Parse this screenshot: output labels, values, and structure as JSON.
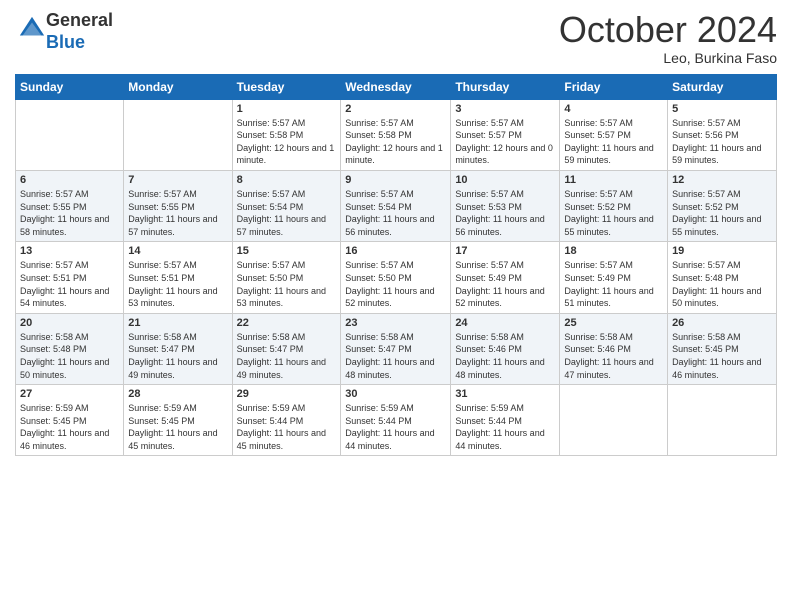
{
  "header": {
    "logo_general": "General",
    "logo_blue": "Blue",
    "month_title": "October 2024",
    "subtitle": "Leo, Burkina Faso"
  },
  "days_of_week": [
    "Sunday",
    "Monday",
    "Tuesday",
    "Wednesday",
    "Thursday",
    "Friday",
    "Saturday"
  ],
  "weeks": [
    [
      {
        "day": "",
        "info": ""
      },
      {
        "day": "",
        "info": ""
      },
      {
        "day": "1",
        "info": "Sunrise: 5:57 AM\nSunset: 5:58 PM\nDaylight: 12 hours\nand 1 minute."
      },
      {
        "day": "2",
        "info": "Sunrise: 5:57 AM\nSunset: 5:58 PM\nDaylight: 12 hours\nand 1 minute."
      },
      {
        "day": "3",
        "info": "Sunrise: 5:57 AM\nSunset: 5:57 PM\nDaylight: 12 hours\nand 0 minutes."
      },
      {
        "day": "4",
        "info": "Sunrise: 5:57 AM\nSunset: 5:57 PM\nDaylight: 11 hours\nand 59 minutes."
      },
      {
        "day": "5",
        "info": "Sunrise: 5:57 AM\nSunset: 5:56 PM\nDaylight: 11 hours\nand 59 minutes."
      }
    ],
    [
      {
        "day": "6",
        "info": "Sunrise: 5:57 AM\nSunset: 5:55 PM\nDaylight: 11 hours\nand 58 minutes."
      },
      {
        "day": "7",
        "info": "Sunrise: 5:57 AM\nSunset: 5:55 PM\nDaylight: 11 hours\nand 57 minutes."
      },
      {
        "day": "8",
        "info": "Sunrise: 5:57 AM\nSunset: 5:54 PM\nDaylight: 11 hours\nand 57 minutes."
      },
      {
        "day": "9",
        "info": "Sunrise: 5:57 AM\nSunset: 5:54 PM\nDaylight: 11 hours\nand 56 minutes."
      },
      {
        "day": "10",
        "info": "Sunrise: 5:57 AM\nSunset: 5:53 PM\nDaylight: 11 hours\nand 56 minutes."
      },
      {
        "day": "11",
        "info": "Sunrise: 5:57 AM\nSunset: 5:52 PM\nDaylight: 11 hours\nand 55 minutes."
      },
      {
        "day": "12",
        "info": "Sunrise: 5:57 AM\nSunset: 5:52 PM\nDaylight: 11 hours\nand 55 minutes."
      }
    ],
    [
      {
        "day": "13",
        "info": "Sunrise: 5:57 AM\nSunset: 5:51 PM\nDaylight: 11 hours\nand 54 minutes."
      },
      {
        "day": "14",
        "info": "Sunrise: 5:57 AM\nSunset: 5:51 PM\nDaylight: 11 hours\nand 53 minutes."
      },
      {
        "day": "15",
        "info": "Sunrise: 5:57 AM\nSunset: 5:50 PM\nDaylight: 11 hours\nand 53 minutes."
      },
      {
        "day": "16",
        "info": "Sunrise: 5:57 AM\nSunset: 5:50 PM\nDaylight: 11 hours\nand 52 minutes."
      },
      {
        "day": "17",
        "info": "Sunrise: 5:57 AM\nSunset: 5:49 PM\nDaylight: 11 hours\nand 52 minutes."
      },
      {
        "day": "18",
        "info": "Sunrise: 5:57 AM\nSunset: 5:49 PM\nDaylight: 11 hours\nand 51 minutes."
      },
      {
        "day": "19",
        "info": "Sunrise: 5:57 AM\nSunset: 5:48 PM\nDaylight: 11 hours\nand 50 minutes."
      }
    ],
    [
      {
        "day": "20",
        "info": "Sunrise: 5:58 AM\nSunset: 5:48 PM\nDaylight: 11 hours\nand 50 minutes."
      },
      {
        "day": "21",
        "info": "Sunrise: 5:58 AM\nSunset: 5:47 PM\nDaylight: 11 hours\nand 49 minutes."
      },
      {
        "day": "22",
        "info": "Sunrise: 5:58 AM\nSunset: 5:47 PM\nDaylight: 11 hours\nand 49 minutes."
      },
      {
        "day": "23",
        "info": "Sunrise: 5:58 AM\nSunset: 5:47 PM\nDaylight: 11 hours\nand 48 minutes."
      },
      {
        "day": "24",
        "info": "Sunrise: 5:58 AM\nSunset: 5:46 PM\nDaylight: 11 hours\nand 48 minutes."
      },
      {
        "day": "25",
        "info": "Sunrise: 5:58 AM\nSunset: 5:46 PM\nDaylight: 11 hours\nand 47 minutes."
      },
      {
        "day": "26",
        "info": "Sunrise: 5:58 AM\nSunset: 5:45 PM\nDaylight: 11 hours\nand 46 minutes."
      }
    ],
    [
      {
        "day": "27",
        "info": "Sunrise: 5:59 AM\nSunset: 5:45 PM\nDaylight: 11 hours\nand 46 minutes."
      },
      {
        "day": "28",
        "info": "Sunrise: 5:59 AM\nSunset: 5:45 PM\nDaylight: 11 hours\nand 45 minutes."
      },
      {
        "day": "29",
        "info": "Sunrise: 5:59 AM\nSunset: 5:44 PM\nDaylight: 11 hours\nand 45 minutes."
      },
      {
        "day": "30",
        "info": "Sunrise: 5:59 AM\nSunset: 5:44 PM\nDaylight: 11 hours\nand 44 minutes."
      },
      {
        "day": "31",
        "info": "Sunrise: 5:59 AM\nSunset: 5:44 PM\nDaylight: 11 hours\nand 44 minutes."
      },
      {
        "day": "",
        "info": ""
      },
      {
        "day": "",
        "info": ""
      }
    ]
  ]
}
